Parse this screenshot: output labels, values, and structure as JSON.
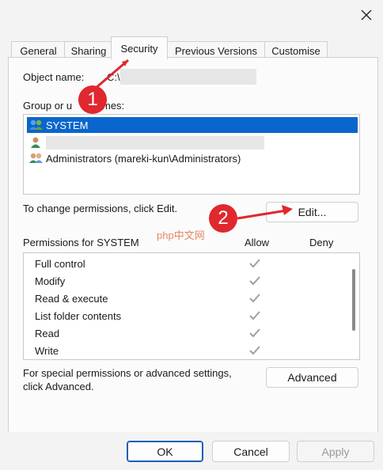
{
  "window": {
    "close_icon": "close-icon"
  },
  "tabs": [
    {
      "label": "General"
    },
    {
      "label": "Sharing"
    },
    {
      "label": "Security",
      "active": true
    },
    {
      "label": "Previous Versions"
    },
    {
      "label": "Customise"
    }
  ],
  "security": {
    "object_name_label": "Object name:",
    "object_name_value": "C:\\",
    "group_label": "Group or user names:",
    "group_label_visible_left": "Group or u",
    "group_label_visible_right": "mes:",
    "users": [
      {
        "name": "SYSTEM",
        "selected": true,
        "icon": "users-group-icon"
      },
      {
        "name": "",
        "icon": "user-icon"
      },
      {
        "name": "Administrators (mareki-kun\\Administrators)",
        "icon": "users-group-icon"
      }
    ],
    "change_permissions_text": "To change permissions, click Edit.",
    "edit_button": "Edit...",
    "permissions_label": "Permissions for SYSTEM",
    "allow_header": "Allow",
    "deny_header": "Deny",
    "permissions": [
      {
        "name": "Full control",
        "allow": true
      },
      {
        "name": "Modify",
        "allow": true
      },
      {
        "name": "Read & execute",
        "allow": true
      },
      {
        "name": "List folder contents",
        "allow": true
      },
      {
        "name": "Read",
        "allow": true
      },
      {
        "name": "Write",
        "allow": true
      }
    ],
    "special_text_line1": "For special permissions or advanced settings,",
    "special_text_line2": "click Advanced.",
    "advanced_button": "Advanced"
  },
  "footer": {
    "ok": "OK",
    "cancel": "Cancel",
    "apply": "Apply"
  },
  "annotations": {
    "callout_1": "1",
    "callout_2": "2",
    "watermark": "php中文网"
  },
  "colors": {
    "selection": "#0a66cc",
    "callout": "#e0282e",
    "check_gray": "#a0a0a0"
  }
}
